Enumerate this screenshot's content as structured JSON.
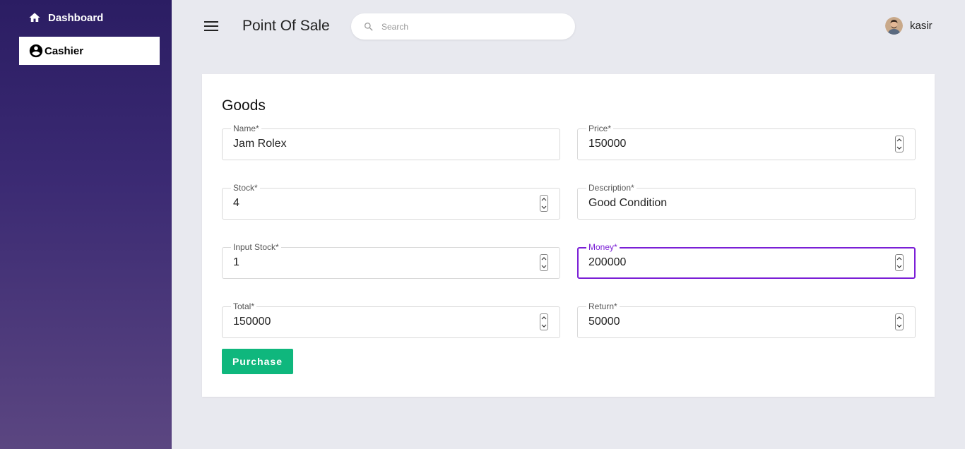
{
  "sidebar": {
    "items": [
      {
        "label": "Dashboard",
        "icon": "home-icon"
      },
      {
        "label": "Cashier",
        "icon": "account-circle-icon",
        "active": true
      }
    ]
  },
  "header": {
    "title": "Point Of Sale",
    "search_placeholder": "Search",
    "username": "kasir"
  },
  "form": {
    "title": "Goods",
    "name": {
      "label": "Name*",
      "value": "Jam Rolex"
    },
    "price": {
      "label": "Price*",
      "value": "150000"
    },
    "stock": {
      "label": "Stock*",
      "value": "4"
    },
    "description": {
      "label": "Description*",
      "value": "Good Condition"
    },
    "input_stock": {
      "label": "Input Stock*",
      "value": "1"
    },
    "money": {
      "label": "Money*",
      "value": "200000"
    },
    "total": {
      "label": "Total*",
      "value": "150000"
    },
    "return": {
      "label": "Return*",
      "value": "50000"
    },
    "purchase_label": "Purchase"
  },
  "colors": {
    "accent": "#7b1fd6",
    "purchase_button": "#0fb77d",
    "sidebar_top": "#2b1d63",
    "sidebar_bottom": "#5b4681",
    "background": "#e8e9ef"
  }
}
